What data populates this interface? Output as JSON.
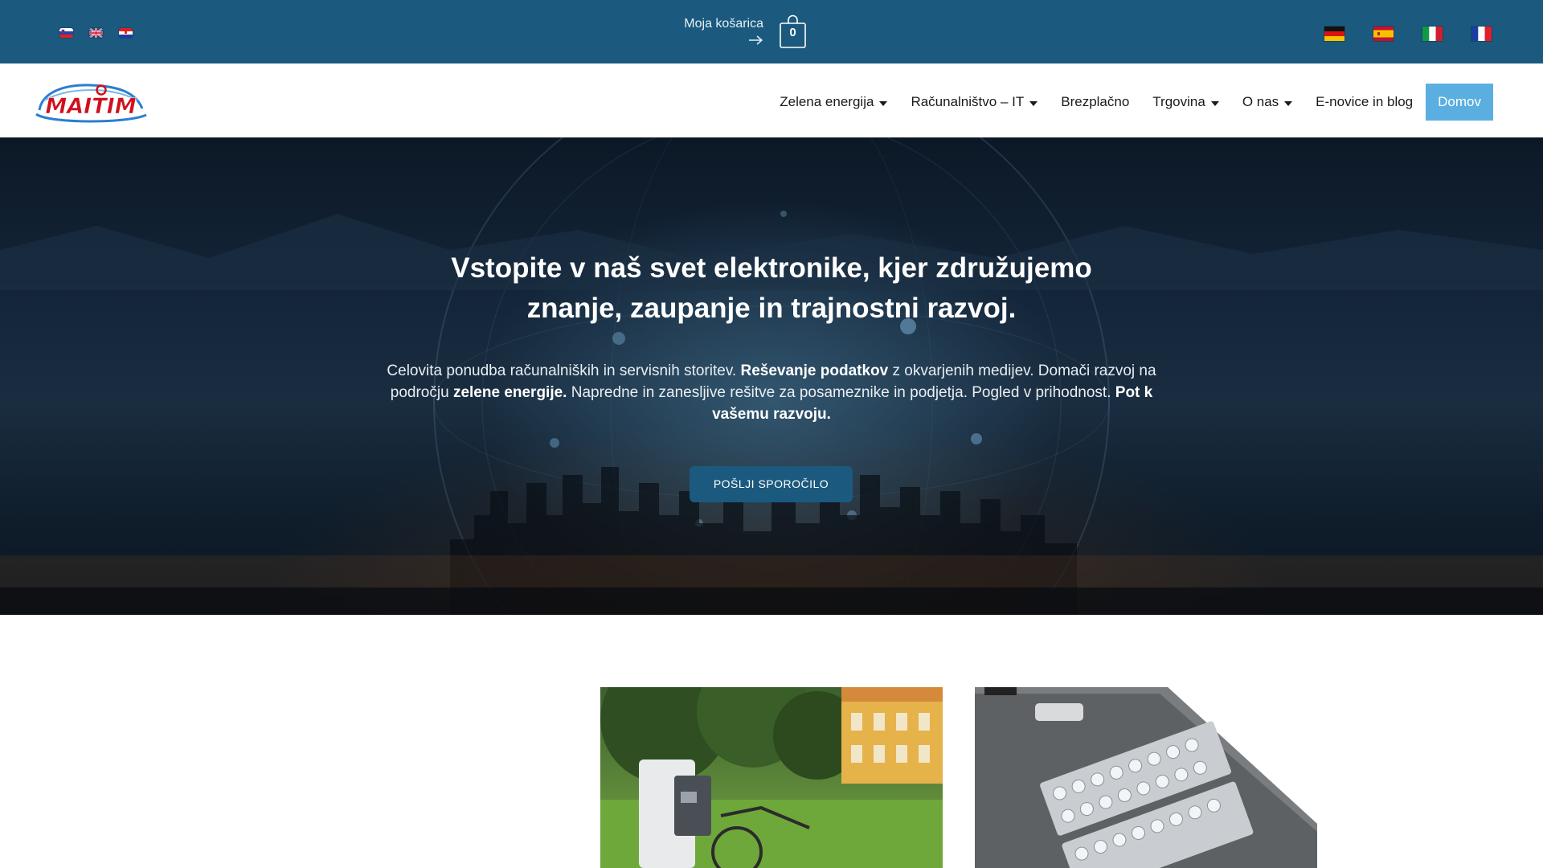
{
  "topbar": {
    "cart": {
      "label": "Moja košarica",
      "count": "0"
    },
    "languages_left": [
      "slovenian-flag-icon",
      "english-flag-icon",
      "croatian-flag-icon"
    ],
    "languages_right": [
      "german-flag-icon",
      "spanish-flag-icon",
      "italian-flag-icon",
      "french-flag-icon"
    ]
  },
  "nav": {
    "logo_text": "MAITIM",
    "items": [
      {
        "label": "Zelena energija",
        "dropdown": true
      },
      {
        "label": "Računalništvo – IT",
        "dropdown": true
      },
      {
        "label": "Brezplačno",
        "dropdown": false
      },
      {
        "label": "Trgovina",
        "dropdown": true
      },
      {
        "label": "O nas",
        "dropdown": true
      },
      {
        "label": "E-novice in blog",
        "dropdown": false
      }
    ],
    "active_label": "Domov"
  },
  "hero": {
    "title_line1": "Vstopite v naš svet elektronike, kjer združujemo",
    "title_line2": "znanje, zaupanje in trajnostni razvoj.",
    "desc": {
      "p1": "Celovita ponudba računalniških in servisnih storitev. ",
      "b1": "Reševanje podatkov",
      "p2": " z okvarjenih medijev. Domači razvoj na področju ",
      "b2": "zelene energije.",
      "p3": " Napredne in zanesljive rešitve za posameznike in podjetja. Pogled v prihodnost. ",
      "b3": "Pot k vašemu razvoju."
    },
    "button": "POŠLJI SPOROČILO"
  },
  "colors": {
    "topbar": "#1b5a7e",
    "accent": "#5aafe0",
    "button": "#1b5a7e",
    "logo_red": "#d0101c",
    "logo_blue": "#2a7fd0"
  }
}
